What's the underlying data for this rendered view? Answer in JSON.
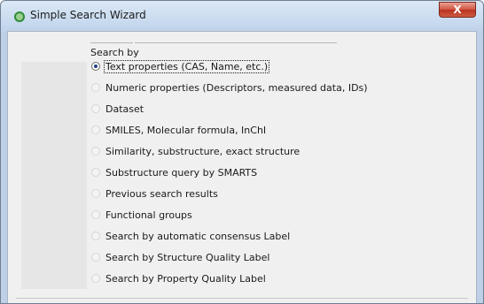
{
  "window": {
    "title": "Simple Search Wizard",
    "close_label": "X"
  },
  "group": {
    "label": "Search by"
  },
  "options": [
    {
      "label": "Text properties (CAS, Name, etc.)",
      "selected": true
    },
    {
      "label": "Numeric properties (Descriptors, measured data, IDs)",
      "selected": false
    },
    {
      "label": "Dataset",
      "selected": false
    },
    {
      "label": "SMILES, Molecular formula, InChI",
      "selected": false
    },
    {
      "label": "Similarity, substructure, exact structure",
      "selected": false
    },
    {
      "label": "Substructure query by SMARTS",
      "selected": false
    },
    {
      "label": "Previous search results",
      "selected": false
    },
    {
      "label": "Functional groups",
      "selected": false
    },
    {
      "label": "Search by automatic consensus Label",
      "selected": false
    },
    {
      "label": "Search by Structure Quality Label",
      "selected": false
    },
    {
      "label": "Search by Property Quality Label",
      "selected": false
    }
  ],
  "colors": {
    "accent": "#1f3f86",
    "close_button": "#c9452f"
  }
}
